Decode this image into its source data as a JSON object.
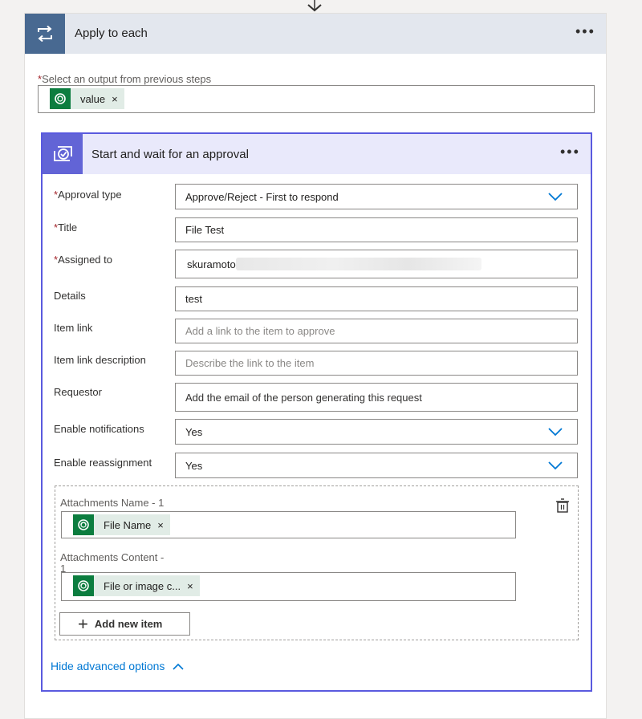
{
  "colors": {
    "loop_header_bg": "#e3e7ee",
    "loop_icon_bg": "#486991",
    "approval_accent": "#5a5adf",
    "approval_header_bg": "#e9e9fb",
    "approval_icon_bg": "#6264d6",
    "token_bg": "#e1ece6",
    "token_icon_bg": "#0c7d3f",
    "link_color": "#0078d4",
    "required_star": "#a4262c"
  },
  "outer": {
    "title": "Apply to each",
    "more_icon": "more-horizontal-icon",
    "loop_icon": "loop-icon",
    "select_label": "Select an output from previous steps",
    "required_mark": "*",
    "token": {
      "icon": "dataverse-icon",
      "label": "value",
      "close": "×"
    }
  },
  "approval": {
    "title": "Start and wait for an approval",
    "icon": "approval-icon",
    "fields": {
      "approval_type": {
        "label": "Approval type",
        "required": "*",
        "value": "Approve/Reject - First to respond"
      },
      "title": {
        "label": "Title",
        "required": "*",
        "value": "File Test"
      },
      "assigned_to": {
        "label": "Assigned to",
        "required": "*",
        "value": "skuramoto"
      },
      "details": {
        "label": "Details",
        "value": "test"
      },
      "item_link": {
        "label": "Item link",
        "placeholder": "Add a link to the item to approve"
      },
      "item_link_description": {
        "label": "Item link description",
        "placeholder": "Describe the link to the item"
      },
      "requestor": {
        "label": "Requestor",
        "placeholder": "Add the email of the person generating this request"
      },
      "enable_notifications": {
        "label": "Enable notifications",
        "value": "Yes"
      },
      "enable_reassignment": {
        "label": "Enable reassignment",
        "value": "Yes"
      }
    },
    "attachments": {
      "name_label": "Attachments Name - 1",
      "name_token": {
        "label": "File Name",
        "close": "×"
      },
      "content_label_line1": "Attachments Content -",
      "content_label_line2": "1",
      "content_token": {
        "label": "File or image c...",
        "close": "×"
      },
      "add_button": "Add new item",
      "add_plus": "+"
    },
    "hide_advanced": "Hide advanced options"
  }
}
